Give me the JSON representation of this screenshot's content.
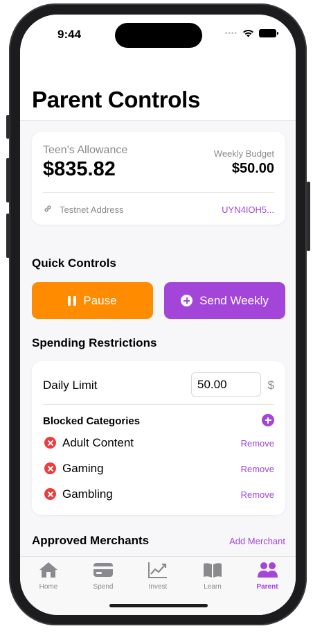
{
  "status_bar": {
    "time": "9:44"
  },
  "header": {
    "title": "Parent Controls"
  },
  "allowance": {
    "label": "Teen's Allowance",
    "balance": "$835.82",
    "budget_label": "Weekly Budget",
    "budget_amount": "$50.00",
    "address_label": "Testnet Address",
    "address_value": "UYN4IOH5..."
  },
  "quick_controls": {
    "title": "Quick Controls",
    "pause_label": "Pause",
    "send_label": "Send Weekly"
  },
  "restrictions": {
    "title": "Spending Restrictions",
    "daily_limit_label": "Daily Limit",
    "daily_limit_value": "50.00",
    "currency": "$",
    "blocked_title": "Blocked Categories",
    "categories": [
      {
        "name": "Adult Content",
        "action": "Remove"
      },
      {
        "name": "Gaming",
        "action": "Remove"
      },
      {
        "name": "Gambling",
        "action": "Remove"
      }
    ]
  },
  "merchants": {
    "title": "Approved Merchants",
    "add_label": "Add Merchant"
  },
  "tabs": [
    {
      "label": "Home",
      "icon": "house-icon"
    },
    {
      "label": "Spend",
      "icon": "card-icon"
    },
    {
      "label": "Invest",
      "icon": "chart-icon"
    },
    {
      "label": "Learn",
      "icon": "book-icon"
    },
    {
      "label": "Parent",
      "icon": "people-icon",
      "active": true
    }
  ],
  "colors": {
    "accent": "#a245d8",
    "pause": "#ff8c00",
    "danger": "#ef3b3b"
  }
}
